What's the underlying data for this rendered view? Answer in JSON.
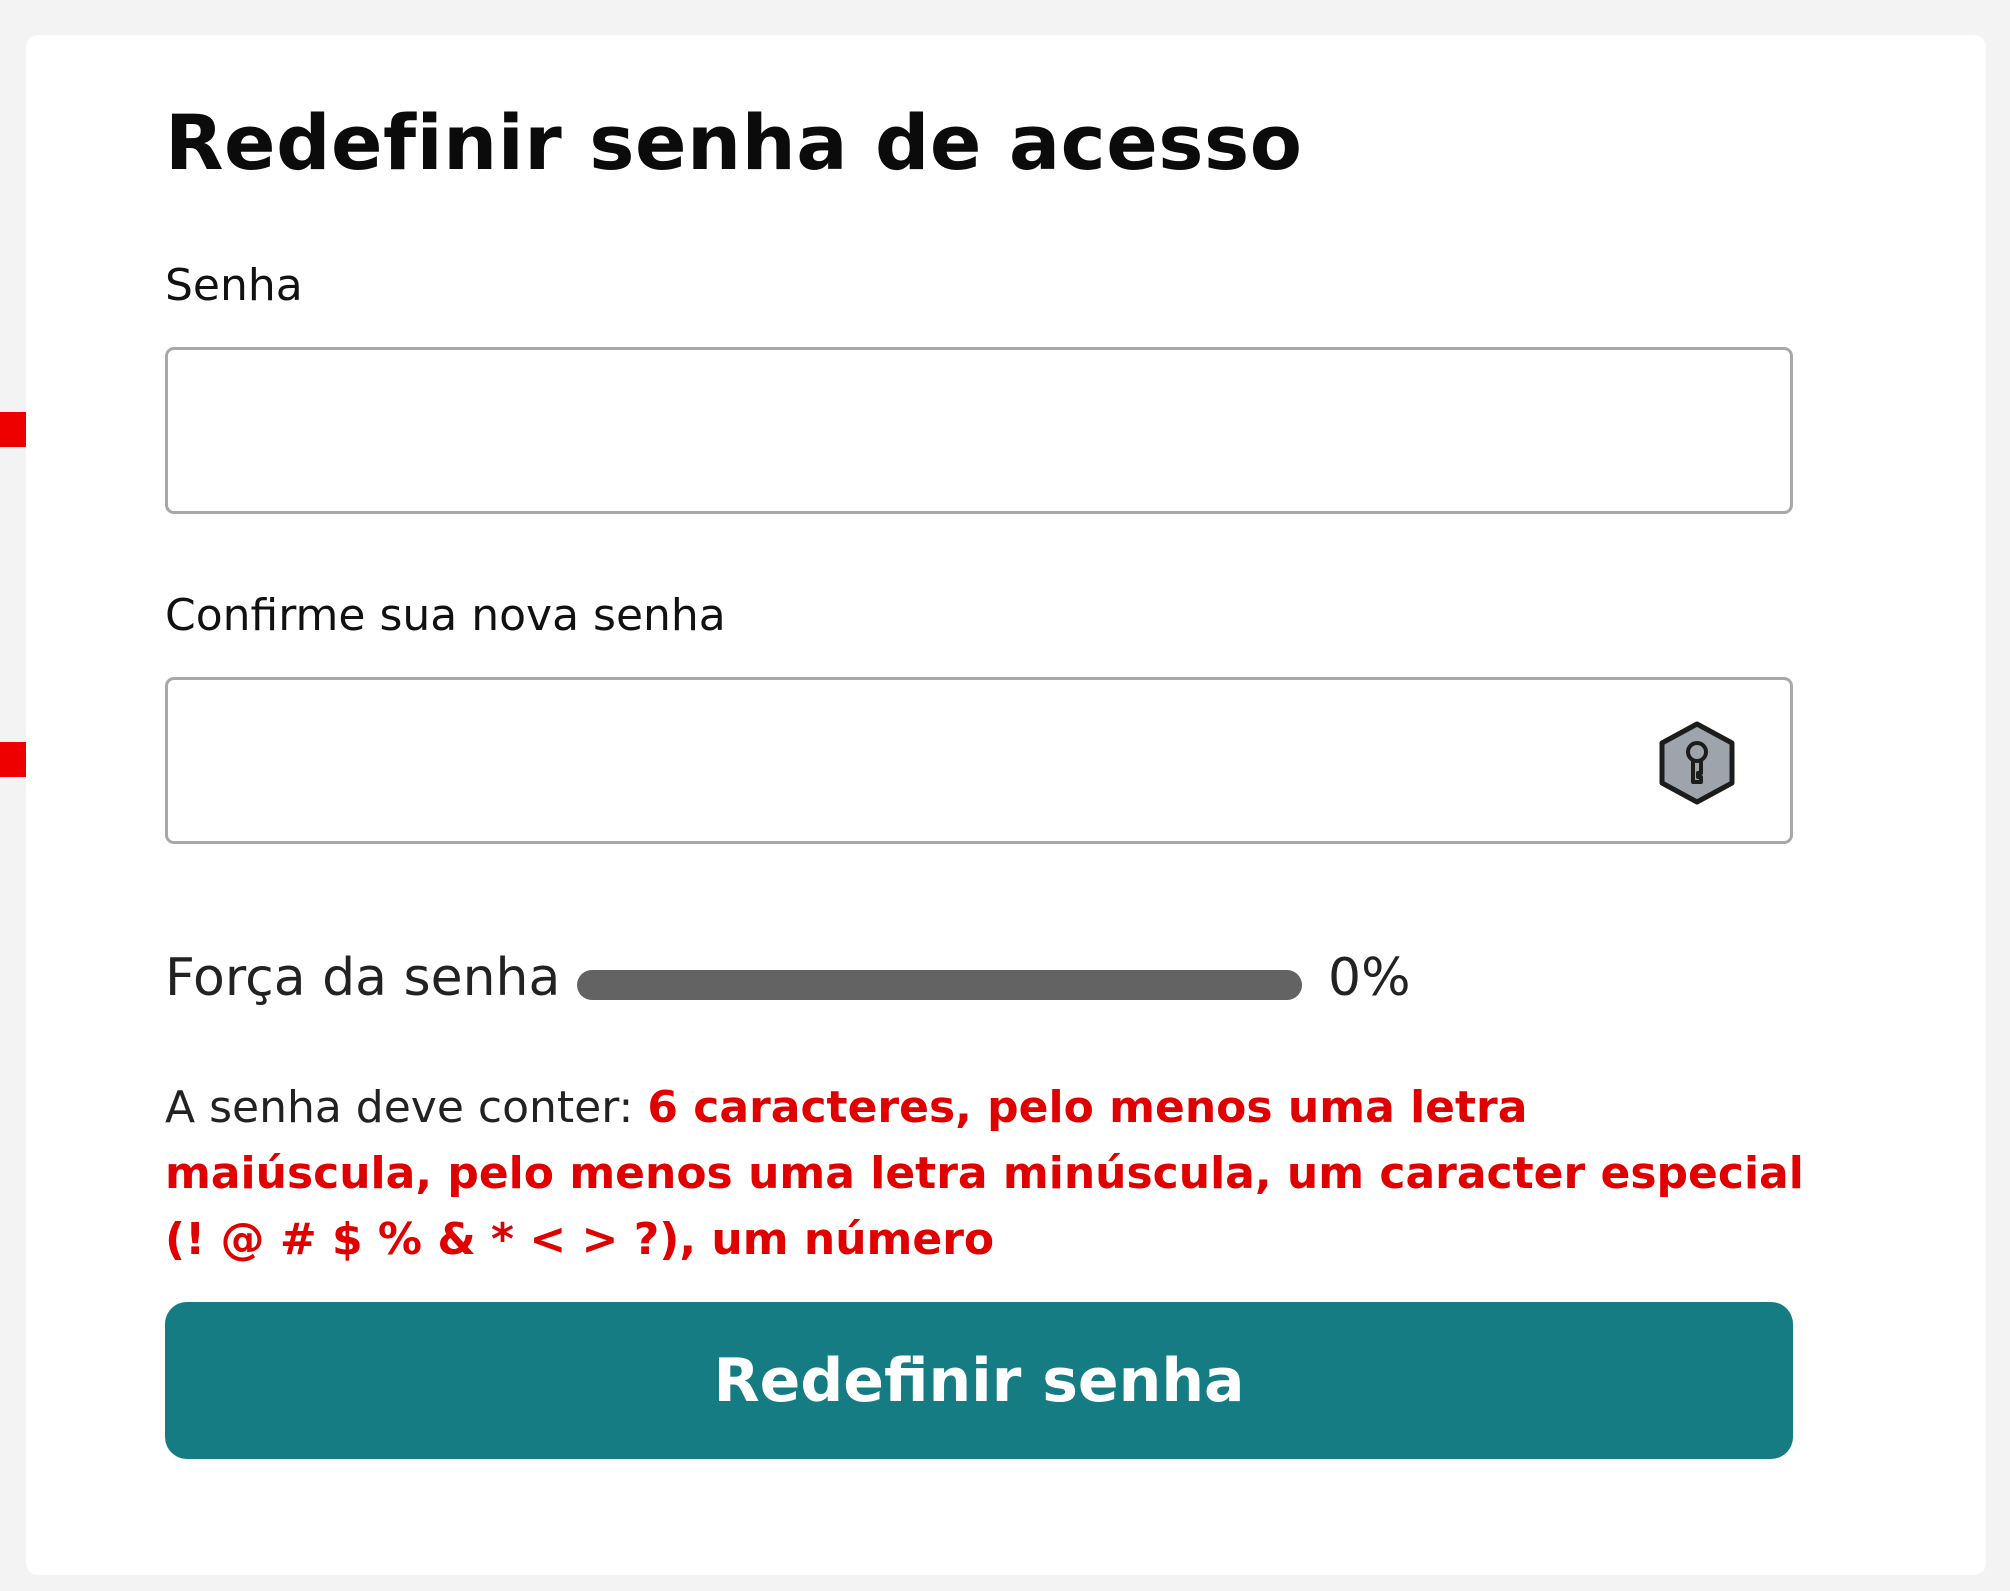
{
  "page": {
    "title": "Redefinir senha de acesso"
  },
  "fields": {
    "password": {
      "label": "Senha",
      "value": "",
      "placeholder": ""
    },
    "confirm_password": {
      "label": "Confirme sua nova senha",
      "value": "",
      "placeholder": "",
      "icon": "key-icon"
    }
  },
  "strength": {
    "label": "Força da senha",
    "value_text": "0%",
    "percent": 0,
    "track_color": "#636363"
  },
  "requirements": {
    "prefix": "A senha deve conter:",
    "list": "6 caracteres, pelo menos uma letra maiúscula, pelo menos uma letra minúscula, um caracter especial (! @ # $ % & * < > ?), um número",
    "list_color": "#e00000"
  },
  "submit": {
    "label": "Redefinir senha",
    "color": "#147c82"
  },
  "annotations": {
    "arrow_color": "#ee0000"
  }
}
